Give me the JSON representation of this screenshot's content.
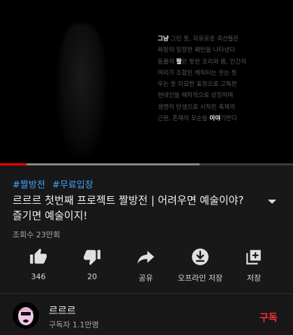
{
  "video": {
    "poem_lines": [
      {
        "lead": "그냥",
        "mid": " 그린 듯, 자유로운 곡선들은",
        "hl2": "",
        "tail": ""
      },
      {
        "lead": "",
        "mid": "욕망의 일정한 패턴을 나타낸다",
        "hl2": "",
        "tail": ""
      },
      {
        "lead": "",
        "mid": "동물의 ",
        "hl2": "짤",
        "tail": "린 듯한 꼬리와 몸, 인간의"
      },
      {
        "lead": "",
        "mid": "머리가 조합된 캐릭터는 웃는 듯",
        "hl2": "",
        "tail": ""
      },
      {
        "lead": "",
        "mid": "우는 듯 미묘한 표정으로 고독한",
        "hl2": "",
        "tail": ""
      },
      {
        "lead": "",
        "mid": "현대인을 해학적으로 상징하며",
        "hl2": "",
        "tail": ""
      },
      {
        "lead": "",
        "mid": "생명의 탄생으로 시작된 축제의",
        "hl2": "",
        "tail": ""
      },
      {
        "lead": "",
        "mid": "근원, 존재의 모순을 ",
        "hl2": "이야",
        "tail": "기한다"
      }
    ],
    "progress": {
      "played_fraction": 0.09,
      "buffered_fraction": 0.68
    }
  },
  "hashtags": [
    "#짤방전",
    "#무료입장"
  ],
  "title": "르르르 첫번째 프로젝트 짤방전 | 어려우면 예술이야? 즐기면 예술이지!",
  "views": "조회수 23만회",
  "actions": {
    "like": {
      "label": "346",
      "icon": "thumbs-up-icon"
    },
    "dislike": {
      "label": "20",
      "icon": "thumbs-down-icon"
    },
    "share": {
      "label": "공유",
      "icon": "share-icon"
    },
    "offline": {
      "label": "오프라인 저장",
      "icon": "download-icon"
    },
    "save": {
      "label": "저장",
      "icon": "add-to-playlist-icon"
    }
  },
  "channel": {
    "name": "르르르",
    "subscribers": "구독자 1.1만명",
    "subscribe_label": "구독",
    "subscribe_color": "#ff2d2d"
  },
  "colors": {
    "background": "#181818",
    "accent_red": "#ff0000",
    "hashtag_blue": "#3ea6ff"
  }
}
